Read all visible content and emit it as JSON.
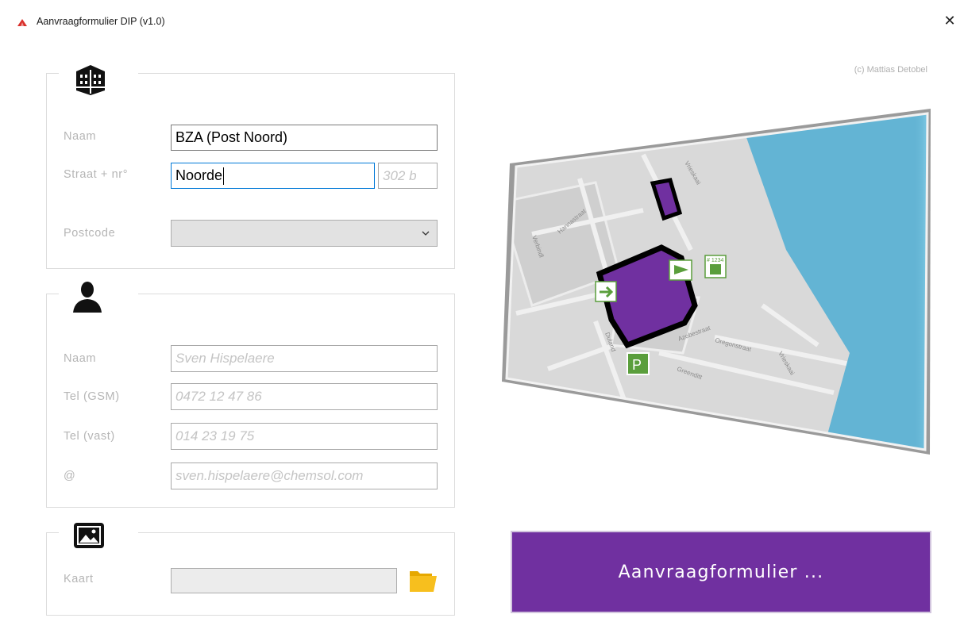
{
  "window": {
    "title": "Aanvraagformulier DIP (v1.0)",
    "close_symbol": "✕",
    "credit": "(c) Mattias Detobel"
  },
  "location": {
    "icon": "building-icon",
    "name_label": "Naam",
    "name_value": "BZA (Post Noord)",
    "street_label": "Straat + nr°",
    "street_value": "Noorde",
    "number_placeholder": "302 b",
    "postcode_label": "Postcode",
    "postcode_value": ""
  },
  "contact": {
    "icon": "person-icon",
    "name_label": "Naam",
    "name_placeholder": "Sven Hispelaere",
    "gsm_label": "Tel (GSM)",
    "gsm_placeholder": "0472 12 47 86",
    "landline_label": "Tel (vast)",
    "landline_placeholder": "014 23 19 75",
    "email_label": "@",
    "email_placeholder": "sven.hispelaere@chemsol.com"
  },
  "map_section": {
    "icon": "image-icon",
    "kaart_label": "Kaart",
    "kaart_value": "",
    "browse_icon": "folder-icon"
  },
  "map_preview": {
    "streets": [
      "Vrieskaai",
      "Hannastraat",
      "Verbindl",
      "Azobestraat",
      "Oregonstraat",
      "Vrieskaai",
      "Duland",
      "Greenditt"
    ],
    "badge_text": "# 1234",
    "parking_letter": "P",
    "colors": {
      "building": "#7030a0",
      "water": "#63b4d4",
      "land": "#d9d9d9"
    }
  },
  "action_button": {
    "label": "Aanvraagformulier ..."
  },
  "colors": {
    "accent": "#7030a0",
    "focus_border": "#0078d7"
  }
}
